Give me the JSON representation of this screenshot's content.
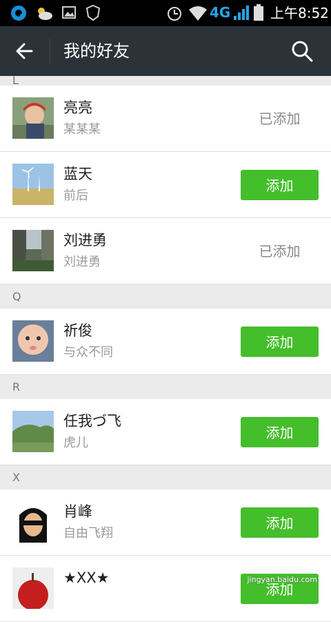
{
  "status_bar": {
    "network": "4G",
    "time": "上午8:52"
  },
  "header": {
    "title": "我的好友"
  },
  "sections": [
    {
      "letter": "L",
      "friends": [
        {
          "name": "亮亮",
          "subtitle": "某某某",
          "status": "已添加"
        },
        {
          "name": "蓝天",
          "subtitle": "前后",
          "status": "添加"
        },
        {
          "name": "刘进勇",
          "subtitle": "刘进勇",
          "status": "已添加"
        }
      ]
    },
    {
      "letter": "Q",
      "friends": [
        {
          "name": "祈俊",
          "subtitle": "与众不同",
          "status": "添加"
        }
      ]
    },
    {
      "letter": "R",
      "friends": [
        {
          "name": "任我づ飞",
          "subtitle": "虎儿",
          "status": "添加"
        }
      ]
    },
    {
      "letter": "X",
      "friends": [
        {
          "name": "肖峰",
          "subtitle": "自由飞翔",
          "status": "添加"
        },
        {
          "name": "★XX★",
          "subtitle": "",
          "status": "添加"
        }
      ]
    }
  ],
  "watermark": "jingyan.baidu.com",
  "colors": {
    "header_bg": "#2b3238",
    "add_button": "#44be2b",
    "section_bg": "#ebebeb"
  }
}
